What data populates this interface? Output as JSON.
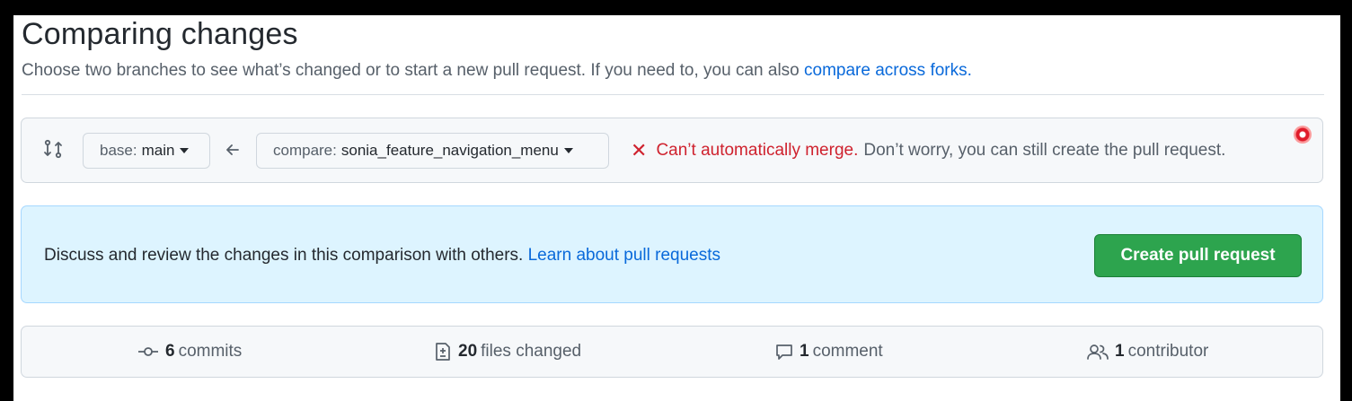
{
  "header": {
    "title": "Comparing changes",
    "subtitle": "Choose two branches to see what’s changed or to start a new pull request. If you need to, you can also",
    "subtitle_link": "compare across forks."
  },
  "range": {
    "base_prefix": "base:",
    "base_branch": "main",
    "compare_prefix": "compare:",
    "compare_branch": "sonia_feature_navigation_menu",
    "merge_status": "Can’t automatically merge.",
    "merge_note": "Don’t worry, you can still create the pull request."
  },
  "discuss": {
    "text": "Discuss and review the changes in this comparison with others.",
    "link": "Learn about pull requests",
    "button": "Create pull request"
  },
  "summary": {
    "commits_count": "6",
    "commits_label": "commits",
    "files_count": "20",
    "files_label": "files changed",
    "comments_count": "1",
    "comments_label": "comment",
    "contributors_count": "1",
    "contributors_label": "contributor"
  },
  "colors": {
    "accent_blue": "#0969da",
    "danger_red": "#cf222e",
    "button_green": "#2da44e",
    "info_bg": "#ddf4ff"
  },
  "icons": [
    "git-compare-icon",
    "arrow-left-icon",
    "x-icon",
    "commit-icon",
    "file-diff-icon",
    "comment-icon",
    "people-icon"
  ]
}
